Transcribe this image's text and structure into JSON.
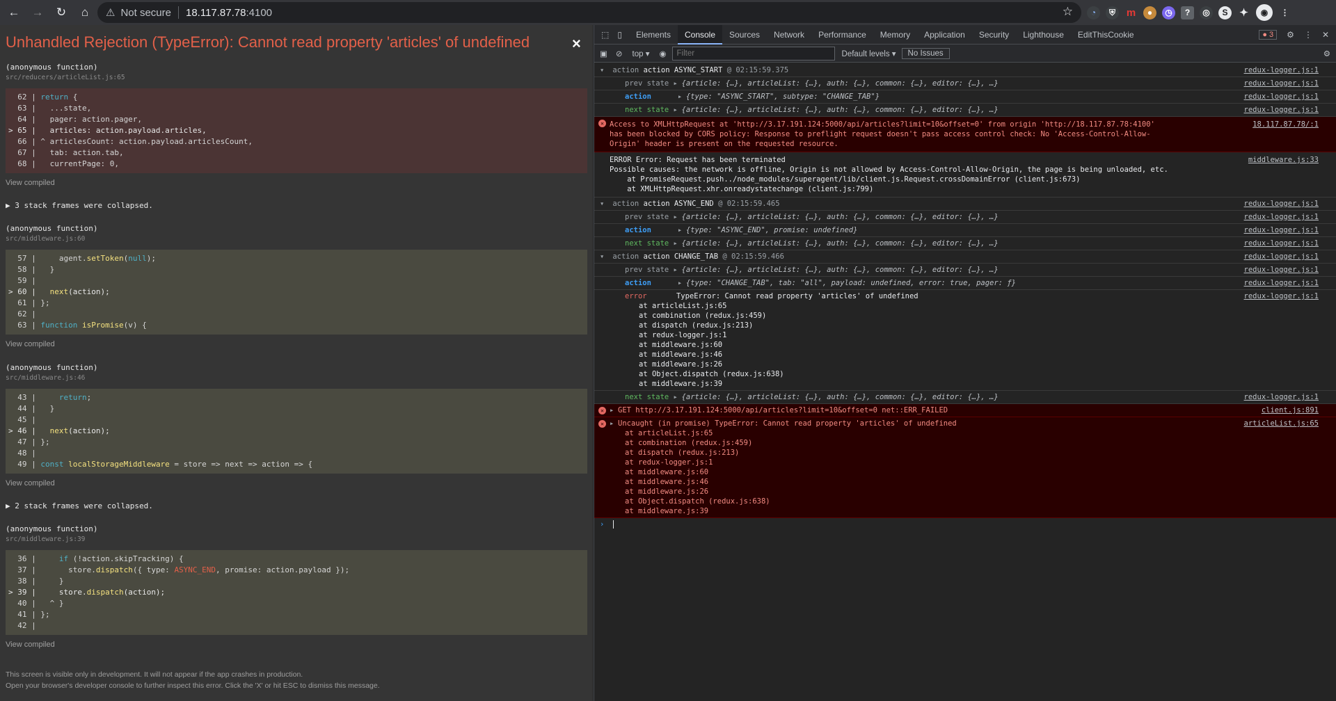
{
  "browser": {
    "security_label": "Not secure",
    "url_host": "18.117.87.78",
    "url_port": ":4100"
  },
  "overlay": {
    "title": "Unhandled Rejection (TypeError): Cannot read property 'articles' of undefined",
    "close_glyph": "×",
    "view_compiled": "View compiled",
    "collapsed_3": "▶ 3 stack frames were collapsed.",
    "collapsed_2": "▶ 2 stack frames were collapsed.",
    "footer_line1": "This screen is visible only in development. It will not appear if the app crashes in production.",
    "footer_line2": "Open your browser's developer console to further inspect this error.  Click the 'X' or hit ESC to dismiss this message.",
    "frames": [
      {
        "fn": "(anonymous function)",
        "file": "src/reducers/articleList.js:65"
      },
      {
        "fn": "(anonymous function)",
        "file": "src/middleware.js:60"
      },
      {
        "fn": "(anonymous function)",
        "file": "src/middleware.js:46"
      },
      {
        "fn": "(anonymous function)",
        "file": "src/middleware.js:39"
      }
    ]
  },
  "devtools": {
    "tabs": [
      "Elements",
      "Console",
      "Sources",
      "Network",
      "Performance",
      "Memory",
      "Application",
      "Security",
      "Lighthouse",
      "EditThisCookie"
    ],
    "active_tab": "Console",
    "error_count": "3",
    "context": "top ▾",
    "filter_placeholder": "Filter",
    "levels": "Default levels ▾",
    "issues": "No Issues"
  },
  "console": {
    "src_logger": "redux-logger.js:1",
    "a1_label": "action ASYNC_START",
    "a1_time": "@ 02:15:59.375",
    "prev_state": "prev state",
    "action": "action",
    "next_state": "next state",
    "state_obj": "{article: {…}, articleList: {…}, auth: {…}, common: {…}, editor: {…}, …}",
    "a1_action": "{type: \"ASYNC_START\", subtype: \"CHANGE_TAB\"}",
    "cors_msg": "Access to XMLHttpRequest at 'http://3.17.191.124:5000/api/articles?limit=10&offset=0' from origin 'http://18.117.87.78:4100' has been blocked by CORS policy: Response to preflight request doesn't pass access control check: No 'Access-Control-Allow-Origin' header is present on the requested resource.",
    "cors_src": "18.117.87.78/:1",
    "req_err1": "ERROR Error: Request has been terminated",
    "req_err2": "Possible causes: the network is offline, Origin is not allowed by Access-Control-Allow-Origin, the page is being unloaded, etc.",
    "req_err3": "    at PromiseRequest.push../node_modules/superagent/lib/client.js.Request.crossDomainError (client.js:673)",
    "req_err4": "    at XMLHttpRequest.xhr.onreadystatechange (client.js:799)",
    "req_src": "middleware.js:33",
    "a2_label": "action ASYNC_END",
    "a2_time": "@ 02:15:59.465",
    "a2_action": "{type: \"ASYNC_END\", promise: undefined}",
    "a3_label": "action CHANGE_TAB",
    "a3_time": "@ 02:15:59.466",
    "a3_action": "{type: \"CHANGE_TAB\", tab: \"all\", payload: undefined, error: true, pager: ƒ}",
    "error_label": "error",
    "error_msg": "TypeError: Cannot read property 'articles' of undefined",
    "stack1": [
      "at articleList.js:65",
      "at combination (redux.js:459)",
      "at dispatch (redux.js:213)",
      "at redux-logger.js:1",
      "at middleware.js:60",
      "at middleware.js:46",
      "at middleware.js:26",
      "at Object.dispatch (redux.js:638)",
      "at middleware.js:39"
    ],
    "get_msg": "GET http://3.17.191.124:5000/api/articles?limit=10&offset=0 net::ERR_FAILED",
    "get_src": "client.js:891",
    "uncaught_msg": "Uncaught (in promise) TypeError: Cannot read property 'articles' of undefined",
    "uncaught_src": "articleList.js:65",
    "stack2": [
      "at articleList.js:65",
      "at combination (redux.js:459)",
      "at dispatch (redux.js:213)",
      "at redux-logger.js:1",
      "at middleware.js:60",
      "at middleware.js:46",
      "at middleware.js:26",
      "at Object.dispatch (redux.js:638)",
      "at middleware.js:39"
    ],
    "prompt": "›"
  }
}
